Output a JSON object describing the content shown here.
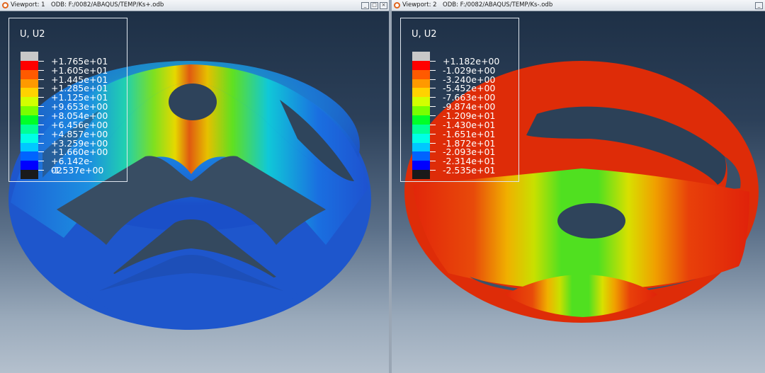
{
  "viewports": [
    {
      "title": "Viewport: 1",
      "odb": "ODB: F:/0082/ABAQUS/TEMP/Ks+.odb",
      "legend_title": "U, U2",
      "legend_values": [
        "+1.765e+01",
        "+1.605e+01",
        "+1.445e+01",
        "+1.285e+01",
        "+1.125e+01",
        "+9.653e+00",
        "+8.054e+00",
        "+6.456e+00",
        "+4.857e+00",
        "+3.259e+00",
        "+1.660e+00",
        "+6.142e-02",
        "-1.537e+00"
      ]
    },
    {
      "title": "Viewport: 2",
      "odb": "ODB: F:/0082/ABAQUS/TEMP/Ks-.odb",
      "legend_title": "U, U2",
      "legend_values": [
        "+1.182e+00",
        "-1.029e+00",
        "-3.240e+00",
        "-5.452e+00",
        "-7.663e+00",
        "-9.874e+00",
        "-1.209e+01",
        "-1.430e+01",
        "-1.651e+01",
        "-1.872e+01",
        "-2.093e+01",
        "-2.314e+01",
        "-2.535e+01"
      ]
    }
  ],
  "legend_colors": [
    "#c8c8c8",
    "#ff0000",
    "#ff5a00",
    "#ff9900",
    "#ffd200",
    "#d2ff00",
    "#78ff00",
    "#00ff28",
    "#00ff96",
    "#00ffe6",
    "#00c8ff",
    "#0064ff",
    "#0000ff",
    "#1a1a1a"
  ],
  "window_buttons": [
    "_",
    "□",
    "×"
  ]
}
